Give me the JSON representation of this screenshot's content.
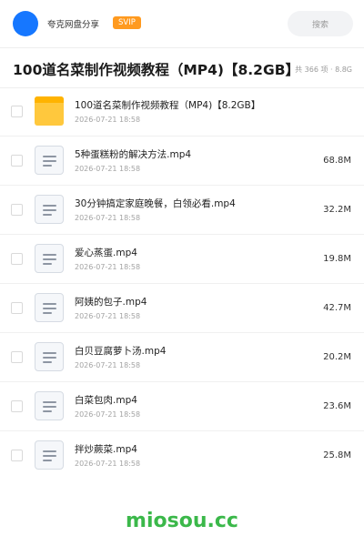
{
  "header": {
    "app_name": "夸克网盘分享",
    "badge": "SVIP",
    "search_label": "搜索",
    "logo_color": "#1677ff",
    "badge_color": "#ff9a1f"
  },
  "folder_title": "100道名菜制作视频教程（MP4)【8.2GB】",
  "item_count": "共 366 项 · 8.8G",
  "files": [
    {
      "name": "100道名菜制作视频教程（MP4)【8.2GB】",
      "date": "2026-07-21 18:58",
      "size": "",
      "icon": "folder-icon"
    },
    {
      "name": "5种蛋糕粉的解决方法.mp4",
      "date": "2026-07-21 18:58",
      "size": "68.8M",
      "icon": "file-icon"
    },
    {
      "name": "30分钟搞定家庭晚餐，白领必看.mp4",
      "date": "2026-07-21 18:58",
      "size": "32.2M",
      "icon": "file-icon"
    },
    {
      "name": "爱心蒸蛋.mp4",
      "date": "2026-07-21 18:58",
      "size": "19.8M",
      "icon": "file-icon"
    },
    {
      "name": "阿姨的包子.mp4",
      "date": "2026-07-21 18:58",
      "size": "42.7M",
      "icon": "file-icon"
    },
    {
      "name": "白贝豆腐萝卜汤.mp4",
      "date": "2026-07-21 18:58",
      "size": "20.2M",
      "icon": "file-icon"
    },
    {
      "name": "白菜包肉.mp4",
      "date": "2026-07-21 18:58",
      "size": "23.6M",
      "icon": "file-icon"
    },
    {
      "name": "拌炒蕨菜.mp4",
      "date": "2026-07-21 18:58",
      "size": "25.8M",
      "icon": "file-icon"
    }
  ],
  "watermark": "miosou.cc",
  "watermark_color": "#3bb84a"
}
